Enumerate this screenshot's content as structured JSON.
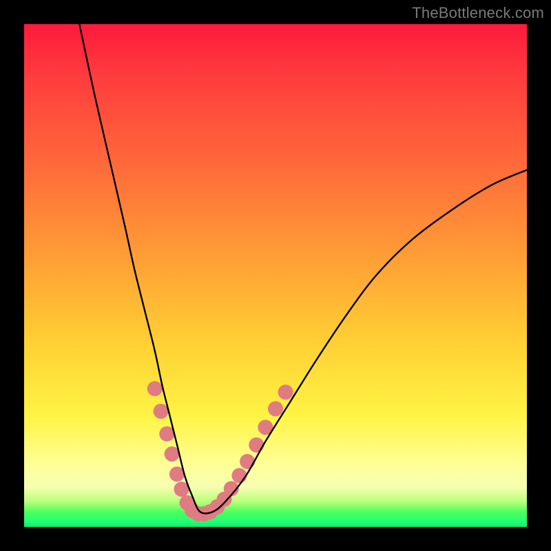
{
  "watermark": {
    "text": "TheBottleneck.com"
  },
  "chart_data": {
    "type": "line",
    "title": "",
    "xlabel": "",
    "ylabel": "",
    "xlim": [
      0,
      100
    ],
    "ylim": [
      0,
      100
    ],
    "series": [
      {
        "name": "bottleneck-curve",
        "x": [
          11,
          14,
          17,
          20,
          22,
          24,
          26,
          27.5,
          29,
          30.5,
          32,
          33.5,
          35,
          37.5,
          40,
          44,
          48,
          53,
          58,
          64,
          70,
          77,
          85,
          93,
          100
        ],
        "y": [
          100,
          86,
          73,
          60,
          51,
          43,
          35,
          28,
          22,
          16,
          10,
          6,
          3,
          3,
          5,
          10,
          17,
          25,
          33,
          42,
          50,
          57,
          63,
          68,
          71
        ]
      }
    ],
    "markers": [
      {
        "name": "highlight-dots",
        "color": "#e07b82",
        "radius_px": 11,
        "points": [
          {
            "x": 26.0,
            "y": 27.5
          },
          {
            "x": 27.2,
            "y": 23.0
          },
          {
            "x": 28.4,
            "y": 18.5
          },
          {
            "x": 29.4,
            "y": 14.5
          },
          {
            "x": 30.4,
            "y": 10.5
          },
          {
            "x": 31.3,
            "y": 7.5
          },
          {
            "x": 32.4,
            "y": 4.8
          },
          {
            "x": 33.4,
            "y": 3.3
          },
          {
            "x": 34.6,
            "y": 2.6
          },
          {
            "x": 35.8,
            "y": 2.6
          },
          {
            "x": 37.0,
            "y": 3.0
          },
          {
            "x": 38.4,
            "y": 4.0
          },
          {
            "x": 39.8,
            "y": 5.5
          },
          {
            "x": 41.2,
            "y": 7.6
          },
          {
            "x": 42.8,
            "y": 10.2
          },
          {
            "x": 44.4,
            "y": 13.0
          },
          {
            "x": 46.2,
            "y": 16.3
          },
          {
            "x": 48.0,
            "y": 19.8
          },
          {
            "x": 50.0,
            "y": 23.5
          },
          {
            "x": 52.0,
            "y": 26.8
          }
        ]
      }
    ]
  }
}
